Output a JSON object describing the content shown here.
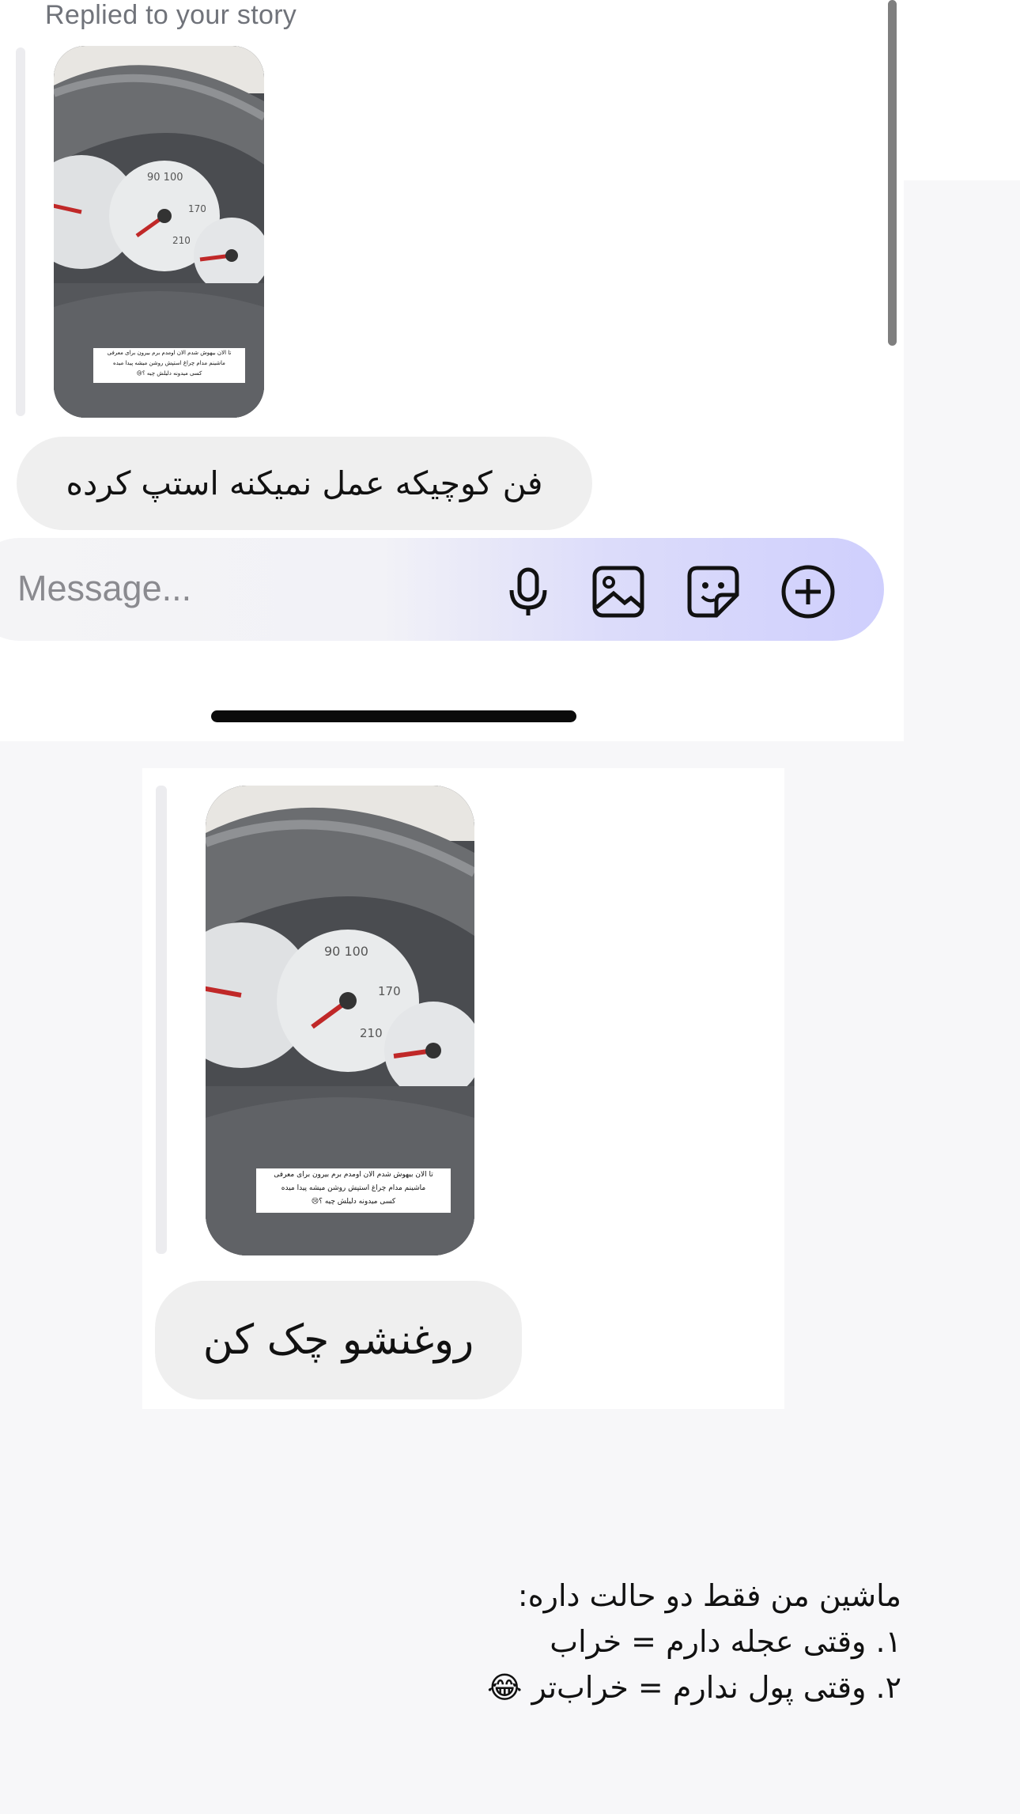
{
  "top_chat": {
    "replied_label": "Replied to your story",
    "story_caption": {
      "line1": "تا الان بیهوش شدم الان اومدم برم بیرون برای معرفی",
      "line2": "ماشینم مدام چراغ استپش روشن میشه پیدا میده",
      "line3": "کسی میدونه دلیلش چیه ؟😢"
    },
    "message_text": "فن کوچیکه عمل نمیکنه استپ کرده"
  },
  "composer": {
    "placeholder": "Message...",
    "icons": [
      "microphone-icon",
      "gallery-icon",
      "sticker-icon",
      "add-circle-icon"
    ]
  },
  "second_chat": {
    "story_caption": {
      "line1": "تا الان بیهوش شدم الان اومدم برم بیرون برای معرفی",
      "line2": "ماشینم مدام چراغ استپش روشن میشه پیدا میده",
      "line3": "کسی میدونه دلیلش چیه ؟😢"
    },
    "message_text": "روغنشو چک کن"
  },
  "caption": {
    "line1": "ماشین من فقط دو حالت داره:",
    "line2": "۱. وقتی عجله دارم = خراب",
    "line3": "۲. وقتی پول ندارم = خراب‌تر 😂"
  },
  "colors": {
    "page_bg": "#f7f7f9",
    "bubble_bg": "#efefef",
    "composer_gradient_end": "#cfcffd",
    "text": "#111111"
  }
}
